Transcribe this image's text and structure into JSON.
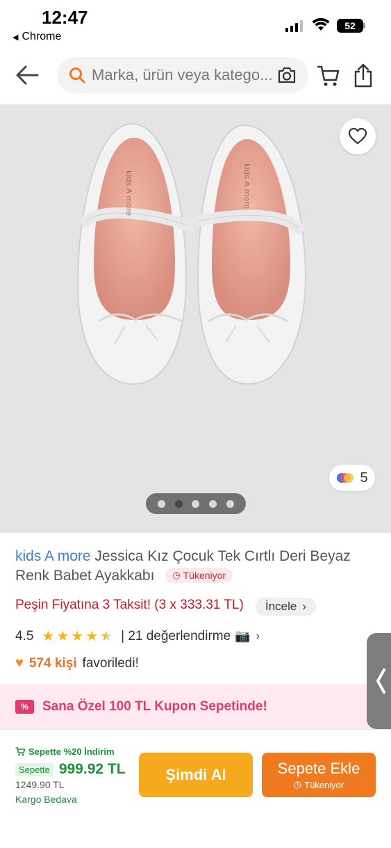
{
  "status_bar": {
    "time": "12:47",
    "back_app": "Chrome",
    "battery": "52"
  },
  "header": {
    "search_placeholder": "Marka, ürün veya katego..."
  },
  "gallery": {
    "variant_count": "5",
    "dots_total": 5,
    "active_dot": 2,
    "shoe_brand_print": "kids A more"
  },
  "product": {
    "brand": "kids A more",
    "title": "Jessica Kız Çocuk Tek Cırtlı Deri Beyaz Renk Babet Ayakkabı",
    "badge": "Tükeniyor",
    "installment": "Peşin Fiyatına 3 Taksit! (3 x 333.31 TL)",
    "installment_link": "İncele",
    "rating": "4.5",
    "rating_stars": 4.5,
    "review_count": "| 21 değerlendirme",
    "fav_count": "574 kişi",
    "fav_text": "favoriledi!",
    "coupon_icon": "%",
    "coupon_text": "Sana Özel 100 TL Kupon Sepetinde!"
  },
  "bottom_bar": {
    "discount_label": "Sepette %20 İndirim",
    "cart_badge": "Sepette",
    "new_price": "999.92 TL",
    "old_price": "1249.90 TL",
    "shipping": "Kargo Bedava",
    "buy_now": "Şimdi Al",
    "add_to_cart": "Sepete Ekle",
    "add_to_cart_sub": "Tükeniyor"
  },
  "colors": {
    "brand_blue": "#3e7fd1",
    "installment_red": "#c21a2b",
    "price_green": "#1d8f3a",
    "buy_now_orange": "#f6a91d",
    "add_cart_orange": "#ef7a1f",
    "coupon_pink": "#e03b6c"
  }
}
